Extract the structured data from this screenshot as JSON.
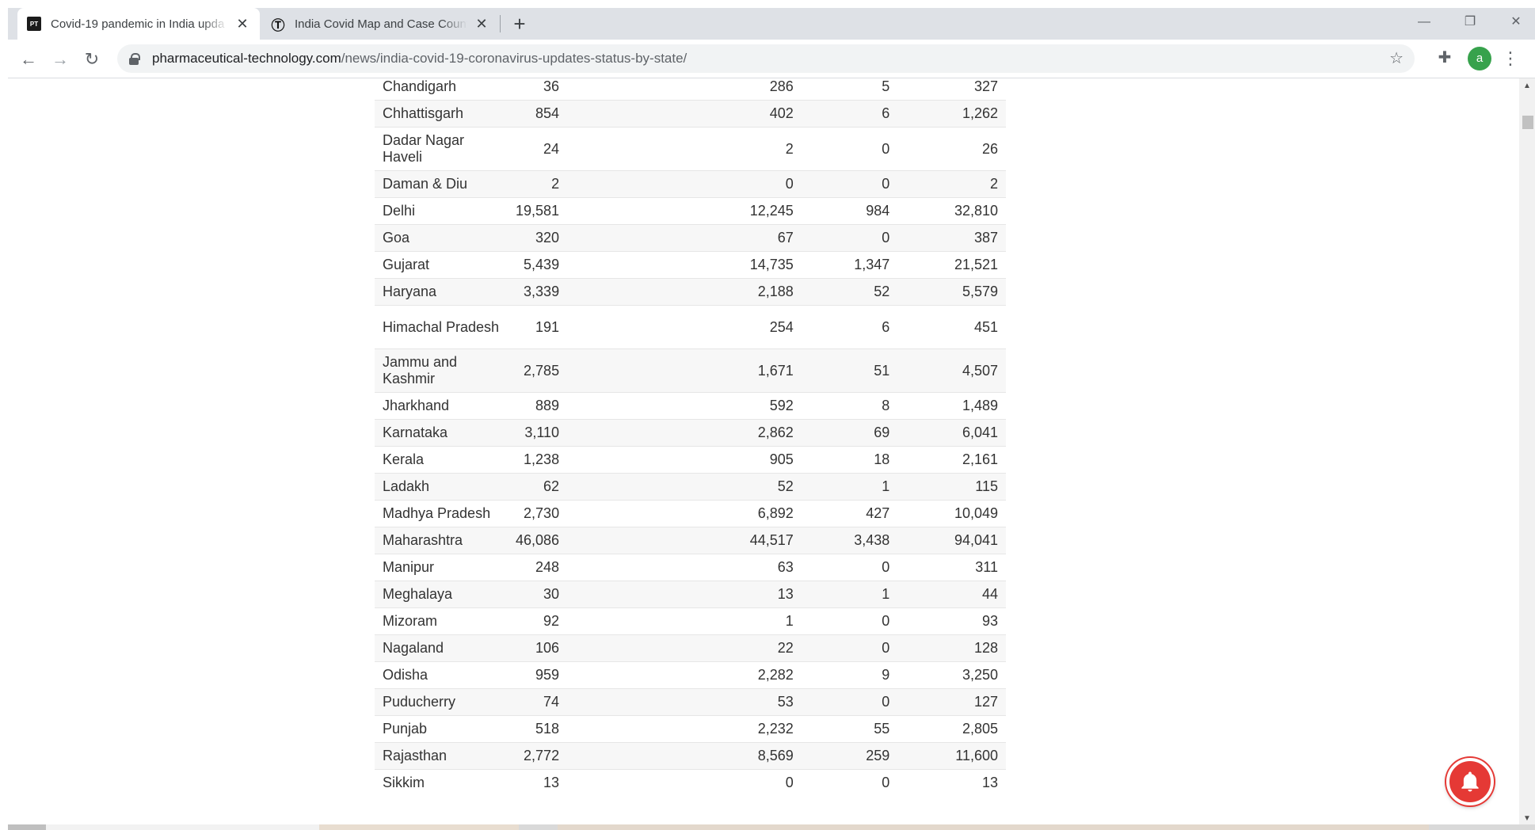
{
  "browser": {
    "tabs": [
      {
        "title": "Covid-19 pandemic in India upda",
        "favicon": "PT",
        "active": true
      },
      {
        "title": "India Covid Map and Case Count",
        "favicon": "Ⓣ",
        "active": false
      }
    ],
    "url_host": "pharmaceutical-technology.com",
    "url_path": "/news/india-covid-19-coronavirus-updates-status-by-state/",
    "profile_initial": "a"
  },
  "table": {
    "rows": [
      {
        "state": "Chandigarh",
        "c1": "36",
        "c2": "286",
        "c3": "5",
        "c4": "327"
      },
      {
        "state": "Chhattisgarh",
        "c1": "854",
        "c2": "402",
        "c3": "6",
        "c4": "1,262"
      },
      {
        "state": "Dadar Nagar Haveli",
        "c1": "24",
        "c2": "2",
        "c3": "0",
        "c4": "26"
      },
      {
        "state": "Daman & Diu",
        "c1": "2",
        "c2": "0",
        "c3": "0",
        "c4": "2"
      },
      {
        "state": "Delhi",
        "c1": "19,581",
        "c2": "12,245",
        "c3": "984",
        "c4": "32,810"
      },
      {
        "state": "Goa",
        "c1": "320",
        "c2": "67",
        "c3": "0",
        "c4": "387"
      },
      {
        "state": "Gujarat",
        "c1": "5,439",
        "c2": "14,735",
        "c3": "1,347",
        "c4": "21,521"
      },
      {
        "state": "Haryana",
        "c1": "3,339",
        "c2": "2,188",
        "c3": "52",
        "c4": "5,579"
      },
      {
        "state": "Himachal Pradesh",
        "c1": "191",
        "c2": "254",
        "c3": "6",
        "c4": "451"
      },
      {
        "state": "Jammu and Kashmir",
        "c1": "2,785",
        "c2": "1,671",
        "c3": "51",
        "c4": "4,507"
      },
      {
        "state": "Jharkhand",
        "c1": "889",
        "c2": "592",
        "c3": "8",
        "c4": "1,489"
      },
      {
        "state": "Karnataka",
        "c1": "3,110",
        "c2": "2,862",
        "c3": "69",
        "c4": "6,041"
      },
      {
        "state": "Kerala",
        "c1": "1,238",
        "c2": "905",
        "c3": "18",
        "c4": "2,161"
      },
      {
        "state": "Ladakh",
        "c1": "62",
        "c2": "52",
        "c3": "1",
        "c4": "115"
      },
      {
        "state": "Madhya Pradesh",
        "c1": "2,730",
        "c2": "6,892",
        "c3": "427",
        "c4": "10,049"
      },
      {
        "state": "Maharashtra",
        "c1": "46,086",
        "c2": "44,517",
        "c3": "3,438",
        "c4": "94,041"
      },
      {
        "state": "Manipur",
        "c1": "248",
        "c2": "63",
        "c3": "0",
        "c4": "311"
      },
      {
        "state": "Meghalaya",
        "c1": "30",
        "c2": "13",
        "c3": "1",
        "c4": "44"
      },
      {
        "state": "Mizoram",
        "c1": "92",
        "c2": "1",
        "c3": "0",
        "c4": "93"
      },
      {
        "state": "Nagaland",
        "c1": "106",
        "c2": "22",
        "c3": "0",
        "c4": "128"
      },
      {
        "state": "Odisha",
        "c1": "959",
        "c2": "2,282",
        "c3": "9",
        "c4": "3,250"
      },
      {
        "state": "Puducherry",
        "c1": "74",
        "c2": "53",
        "c3": "0",
        "c4": "127"
      },
      {
        "state": "Punjab",
        "c1": "518",
        "c2": "2,232",
        "c3": "55",
        "c4": "2,805"
      },
      {
        "state": "Rajasthan",
        "c1": "2,772",
        "c2": "8,569",
        "c3": "259",
        "c4": "11,600"
      },
      {
        "state": "Sikkim",
        "c1": "13",
        "c2": "0",
        "c3": "0",
        "c4": "13"
      }
    ]
  },
  "colors": {
    "notification_bell": "#e53935",
    "profile_avatar": "#37a24c"
  }
}
